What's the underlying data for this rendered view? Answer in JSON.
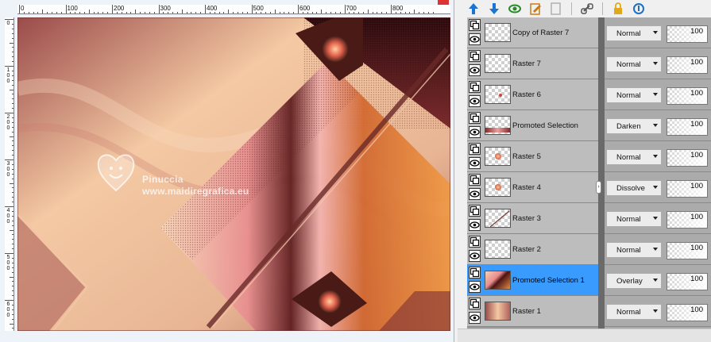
{
  "ruler": {
    "top_labels": [
      "0",
      "100",
      "200",
      "300",
      "400",
      "500",
      "600",
      "700",
      "800"
    ],
    "left_labels": [
      "0",
      "100",
      "200",
      "300",
      "400",
      "500",
      "600"
    ]
  },
  "watermark": {
    "name": "Pinuccia",
    "url": "www.maidiregrafica.eu"
  },
  "toolbar": {
    "buttons": [
      {
        "name": "move-layer-up-icon",
        "color": "#1a75d2"
      },
      {
        "name": "move-layer-down-icon",
        "color": "#1a75d2"
      },
      {
        "name": "visibility-toggle-icon",
        "color": "#2a8a2a"
      },
      {
        "name": "edit-selection-icon",
        "color": "#c97a16"
      },
      {
        "name": "new-layer-icon",
        "color": "#b0b0b0"
      },
      {
        "name": "link-layers-icon",
        "color": "#555555"
      },
      {
        "name": "lock-transparency-icon",
        "color": "#e0a91c"
      },
      {
        "name": "properties-icon",
        "color": "#1e6fc4"
      }
    ]
  },
  "layers": [
    {
      "name": "Copy of Raster 7",
      "blend_mode": "Normal",
      "opacity": "100",
      "selected": false,
      "thumb": "empty"
    },
    {
      "name": "Raster 7",
      "blend_mode": "Normal",
      "opacity": "100",
      "selected": false,
      "thumb": "empty"
    },
    {
      "name": "Raster 6",
      "blend_mode": "Normal",
      "opacity": "100",
      "selected": false,
      "thumb": "dot"
    },
    {
      "name": "Promoted Selection",
      "blend_mode": "Darken",
      "opacity": "100",
      "selected": false,
      "thumb": "stripe"
    },
    {
      "name": "Raster 5",
      "blend_mode": "Normal",
      "opacity": "100",
      "selected": false,
      "thumb": "flower"
    },
    {
      "name": "Raster 4",
      "blend_mode": "Dissolve",
      "opacity": "100",
      "selected": false,
      "thumb": "flower"
    },
    {
      "name": "Raster 3",
      "blend_mode": "Normal",
      "opacity": "100",
      "selected": false,
      "thumb": "line"
    },
    {
      "name": "Raster 2",
      "blend_mode": "Normal",
      "opacity": "100",
      "selected": false,
      "thumb": "empty"
    },
    {
      "name": "Promoted Selection 1",
      "blend_mode": "Overlay",
      "opacity": "100",
      "selected": true,
      "thumb": "art"
    },
    {
      "name": "Raster 1",
      "blend_mode": "Normal",
      "opacity": "100",
      "selected": false,
      "thumb": "full"
    }
  ],
  "colors": {
    "selected_row": "#3a9bff",
    "art_rose": "#a5524e",
    "art_peach": "#f2c197",
    "art_dark": "#3b0f12",
    "art_orange": "#e78a3a"
  }
}
